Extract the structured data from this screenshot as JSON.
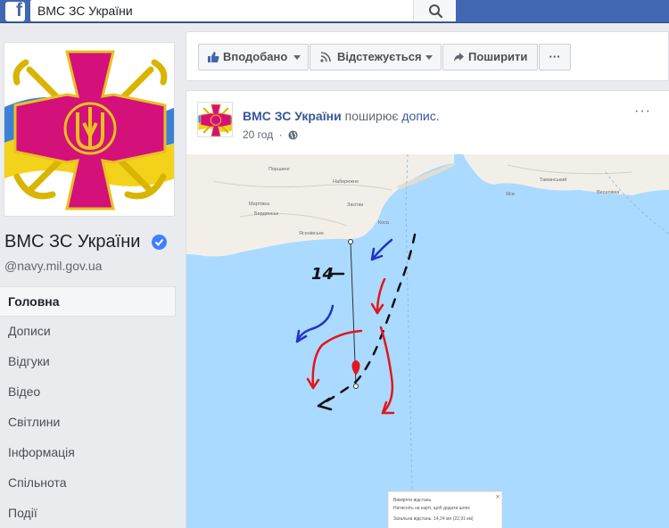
{
  "topbar": {
    "logo_letter": "f",
    "search_value": "ВМС ЗС України"
  },
  "page": {
    "name": "ВМС ЗС України",
    "handle": "@navy.mil.gov.ua"
  },
  "nav": {
    "items": [
      {
        "label": "Головна"
      },
      {
        "label": "Дописи"
      },
      {
        "label": "Відгуки"
      },
      {
        "label": "Відео"
      },
      {
        "label": "Світлини"
      },
      {
        "label": "Інформація"
      },
      {
        "label": "Спільнота"
      },
      {
        "label": "Події"
      }
    ]
  },
  "actions": {
    "like_label": "Вподобано",
    "follow_label": "Відстежується",
    "share_label": "Поширити",
    "more_label": "···"
  },
  "post": {
    "author": "ВМС ЗС України",
    "action_text": "поширює",
    "action_link": "допис.",
    "time": "20 год",
    "more": "···"
  },
  "map": {
    "place_labels": [
      "Поршине",
      "Набережне",
      "Мартівка",
      "Засітки",
      "Бердянськ",
      "Коса",
      "Ясенівське",
      "Таманський",
      "Веселівка",
      "Яси"
    ],
    "handwritten_number": "14",
    "popup": {
      "title": "Виміряти відстань",
      "hint": "Натисніть на карті, щоб додати шлях",
      "total": "Загальна відстань: 14,24 мл (22,91 км)"
    }
  },
  "colors": {
    "facebook_blue": "#4267b2",
    "link_blue": "#385898",
    "sea": "#aadaff",
    "land": "#f2efe9",
    "arrow_red": "#e3161b",
    "arrow_blue": "#2033c7",
    "arrow_black": "#111111",
    "emblem_cross": "#d4107a",
    "emblem_anchor": "#d9b400"
  }
}
